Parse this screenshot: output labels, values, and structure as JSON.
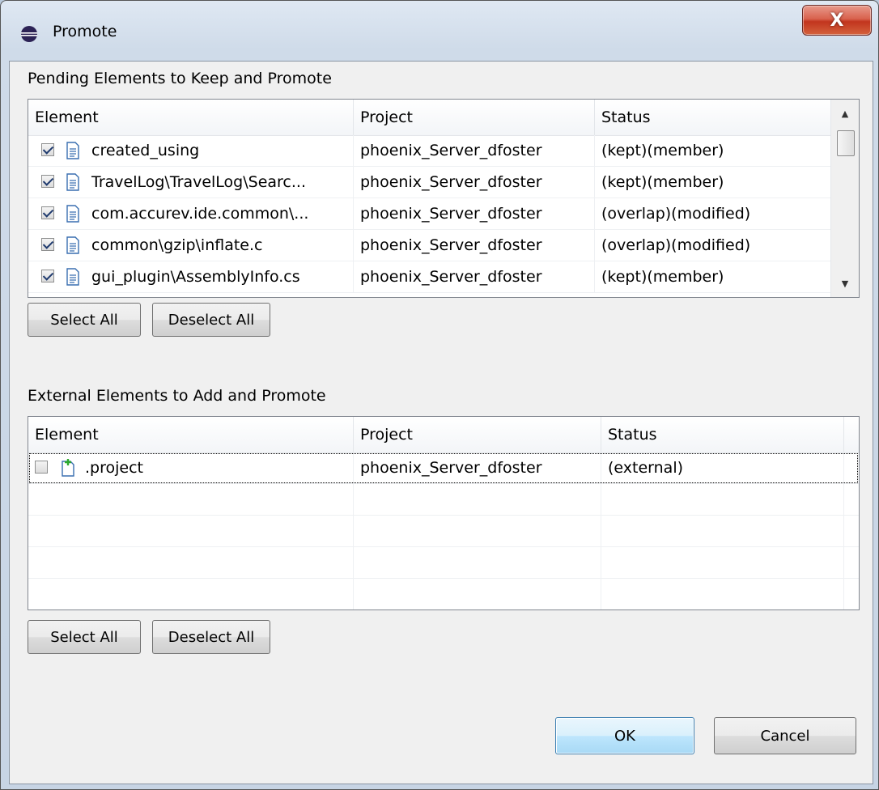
{
  "window": {
    "title": "Promote",
    "close_label": "X"
  },
  "pending": {
    "label": "Pending Elements to Keep and Promote",
    "columns": [
      "Element",
      "Project",
      "Status"
    ],
    "rows": [
      {
        "element": "created_using",
        "project": "phoenix_Server_dfoster",
        "status": "(kept)(member)",
        "checked": true
      },
      {
        "element": "TravelLog\\TravelLog\\Searc...",
        "project": "phoenix_Server_dfoster",
        "status": "(kept)(member)",
        "checked": true
      },
      {
        "element": "com.accurev.ide.common\\...",
        "project": "phoenix_Server_dfoster",
        "status": "(overlap)(modified)",
        "checked": true
      },
      {
        "element": "common\\gzip\\inflate.c",
        "project": "phoenix_Server_dfoster",
        "status": "(overlap)(modified)",
        "checked": true
      },
      {
        "element": "gui_plugin\\AssemblyInfo.cs",
        "project": "phoenix_Server_dfoster",
        "status": "(kept)(member)",
        "checked": true
      }
    ],
    "select_all": "Select All",
    "deselect_all": "Deselect All"
  },
  "external": {
    "label": "External Elements to Add and Promote",
    "columns": [
      "Element",
      "Project",
      "Status"
    ],
    "rows": [
      {
        "element": ".project",
        "project": "phoenix_Server_dfoster",
        "status": "(external)",
        "checked": false
      }
    ],
    "select_all": "Select All",
    "deselect_all": "Deselect All"
  },
  "footer": {
    "ok": "OK",
    "cancel": "Cancel"
  }
}
